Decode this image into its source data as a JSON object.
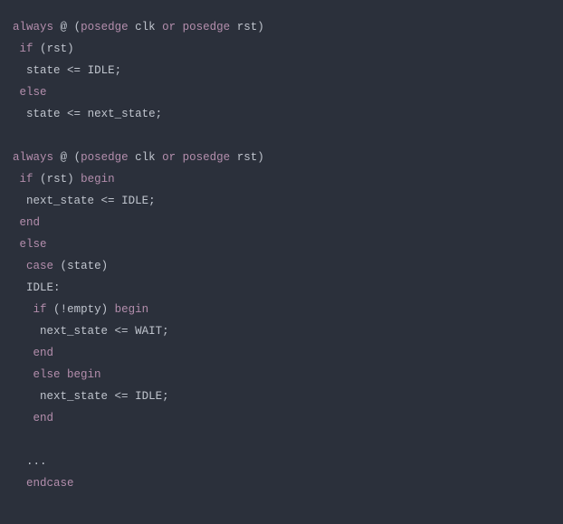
{
  "code": {
    "kw_always_1": "always",
    "at_1": "@",
    "lp_1": "(",
    "kw_posedge_1a": "posedge",
    "id_clk_1": "clk",
    "kw_or_1": "or",
    "kw_posedge_1b": "posedge",
    "id_rst_1": "rst",
    "rp_1": ")",
    "kw_if_1": "if",
    "lp_if1": "(",
    "id_rst_if1": "rst",
    "rp_if1": ")",
    "id_state_1": "state",
    "op_le_1": "<=",
    "id_idle_1": "IDLE",
    "semi_1": ";",
    "kw_else_1": "else",
    "id_state_2": "state",
    "op_le_2": "<=",
    "id_next_1": "next_state",
    "semi_2": ";",
    "kw_always_2": "always",
    "at_2": "@",
    "lp_2": "(",
    "kw_posedge_2a": "posedge",
    "id_clk_2": "clk",
    "kw_or_2": "or",
    "kw_posedge_2b": "posedge",
    "id_rst_2": "rst",
    "rp_2": ")",
    "kw_if_2": "if",
    "lp_if2": "(",
    "id_rst_if2": "rst",
    "rp_if2": ")",
    "kw_begin_1": "begin",
    "id_next_2": "next_state",
    "op_le_3": "<=",
    "id_idle_2": "IDLE",
    "semi_3": ";",
    "kw_end_1": "end",
    "kw_else_2": "else",
    "kw_case": "case",
    "lp_case": "(",
    "id_state_3": "state",
    "rp_case": ")",
    "label_idle": "IDLE",
    "colon_idle": ":",
    "kw_if_3": "if",
    "lp_if3": "(",
    "bang": "!",
    "id_empty": "empty",
    "rp_if3": ")",
    "kw_begin_2": "begin",
    "id_next_3": "next_state",
    "op_le_4": "<=",
    "id_wait": "WAIT",
    "semi_4": ";",
    "kw_end_2": "end",
    "kw_else_3": "else",
    "kw_begin_3": "begin",
    "id_next_4": "next_state",
    "op_le_5": "<=",
    "id_idle_3": "IDLE",
    "semi_5": ";",
    "kw_end_3": "end",
    "ellipsis": "...",
    "kw_endcase": "endcase"
  }
}
